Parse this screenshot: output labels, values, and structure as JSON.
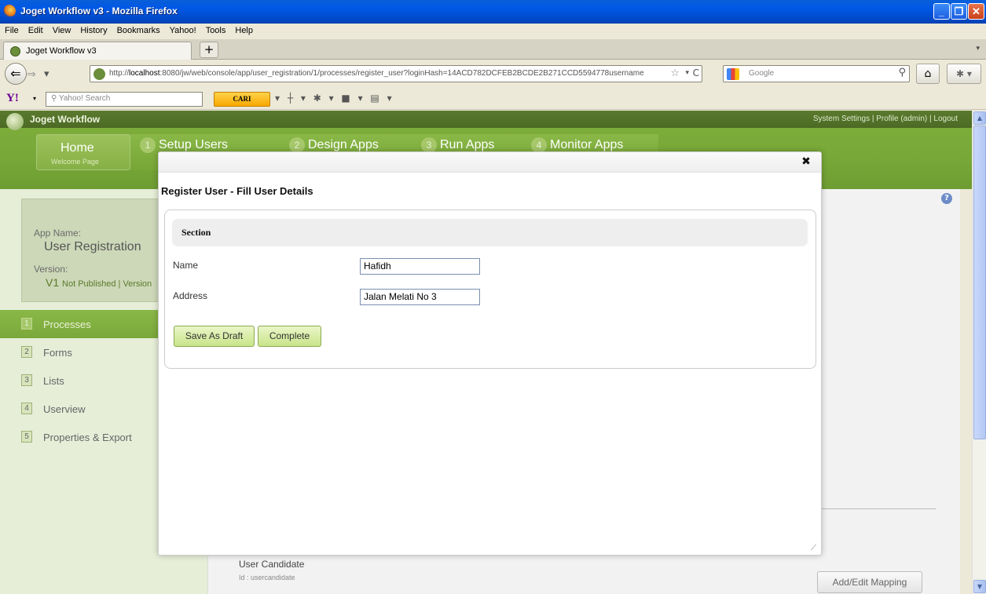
{
  "window": {
    "title": "Joget Workflow v3 - Mozilla Firefox",
    "min": "_",
    "max": "❐",
    "close": "✕"
  },
  "menu": [
    "File",
    "Edit",
    "View",
    "History",
    "Bookmarks",
    "Yahoo!",
    "Tools",
    "Help"
  ],
  "tab": {
    "label": "Joget Workflow v3",
    "new": "+",
    "list": "▾"
  },
  "nav": {
    "back": "⇐",
    "forward": "⇒",
    "history": "▾",
    "url_prefix": "http://",
    "url_host": "localhost",
    "url_rest": ":8080/jw/web/console/app/user_registration/1/processes/register_user?loginHash=14ACD782DCFEB2BCDE2B271CCD5594778username",
    "star": "☆",
    "url_drop": "▾",
    "reload": "C",
    "search_placeholder": "Google",
    "search_icon": "⚲",
    "home": "⌂",
    "addon": "✱ ▾"
  },
  "yahoo": {
    "logo": "Y!",
    "drop": "▾",
    "search_placeholder": "Yahoo! Search",
    "cari": "CARI",
    "tools": "▾ ┼ ▾ ✱ ▾ ■ ▾ ▤ ▾"
  },
  "app": {
    "brand": "Joget Workflow",
    "top_links": "System Settings | Profile (admin) | Logout",
    "home_label": "Home",
    "home_sub": "Welcome Page",
    "tabs": [
      {
        "num": "1",
        "label": "Setup Users"
      },
      {
        "num": "2",
        "label": "Design Apps"
      },
      {
        "num": "3",
        "label": "Run Apps"
      },
      {
        "num": "4",
        "label": "Monitor Apps"
      }
    ],
    "app_name_label": "App Name:",
    "app_name": "User Registration",
    "version_label": "Version:",
    "version_num": "V1",
    "version_status": "Not Published | Version",
    "menu": [
      {
        "num": "1",
        "label": "Processes"
      },
      {
        "num": "2",
        "label": "Forms"
      },
      {
        "num": "3",
        "label": "Lists"
      },
      {
        "num": "4",
        "label": "Userview"
      },
      {
        "num": "5",
        "label": "Properties & Export"
      }
    ],
    "help": "?",
    "participant": "User Candidate",
    "participant_id": "Id : usercandidate",
    "mapping_button": "Add/Edit Mapping"
  },
  "dialog": {
    "close": "✖",
    "heading": "Register User - Fill User Details",
    "section": "Section",
    "name_label": "Name",
    "name_value": "Hafidh",
    "address_label": "Address",
    "address_value": "Jalan Melati No 3",
    "save_draft": "Save As Draft",
    "complete": "Complete",
    "resize": "⟋"
  },
  "scroll": {
    "up": "▲",
    "down": "▼"
  }
}
